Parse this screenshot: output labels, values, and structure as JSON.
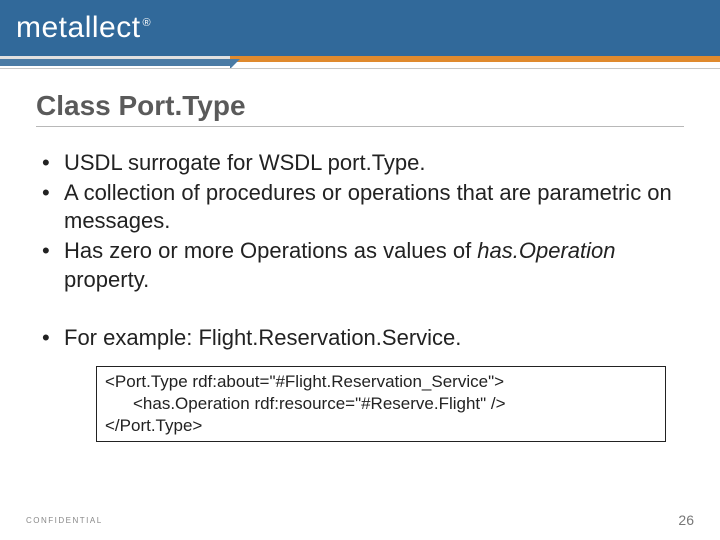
{
  "header": {
    "logo_text": "metallect",
    "reg_mark": "®"
  },
  "title": "Class Port.Type",
  "bullets": [
    {
      "text": "USDL surrogate for WSDL port.Type."
    },
    {
      "text": "A collection of procedures or operations that are parametric on messages."
    },
    {
      "prefix": "Has zero or more Operations as values of ",
      "italic": "has.Operation",
      "suffix": " property."
    }
  ],
  "example_bullet": "For example: Flight.Reservation.Service.",
  "code": {
    "line1": "<Port.Type rdf:about=\"#Flight.Reservation_Service\">",
    "line2": "<has.Operation rdf:resource=\"#Reserve.Flight\" />",
    "line3": "</Port.Type>"
  },
  "footer": {
    "confidential": "CONFIDENTIAL",
    "page": "26"
  }
}
